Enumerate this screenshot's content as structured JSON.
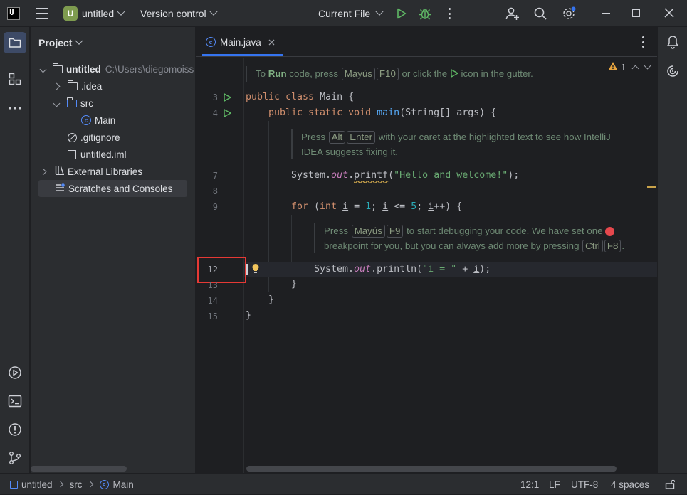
{
  "titlebar": {
    "logo": "IJ",
    "project_badge": "U",
    "project_name": "untitled",
    "vcs": "Version control",
    "run_config": "Current File",
    "icons": [
      "hamburger-menu-icon",
      "run-icon",
      "debug-icon",
      "more-vert-icon",
      "add-user-icon",
      "search-icon",
      "settings-icon",
      "minimize-icon",
      "maximize-icon",
      "close-icon"
    ]
  },
  "project_panel": {
    "title": "Project",
    "tree": [
      {
        "label": "untitled",
        "path": "C:\\Users\\diegomoiss"
      },
      {
        "label": ".idea"
      },
      {
        "label": "src"
      },
      {
        "label": "Main"
      },
      {
        "label": ".gitignore"
      },
      {
        "label": "untitled.iml"
      },
      {
        "label": "External Libraries"
      },
      {
        "label": "Scratches and Consoles"
      }
    ]
  },
  "editor": {
    "tab_label": "Main.java",
    "warning_count": "1",
    "hints": {
      "run": {
        "a": "To ",
        "b": "Run",
        "c": " code, press ",
        "k1": "Mayús",
        "k2": "F10",
        "d": " or click the ",
        "e": " icon in the gutter."
      },
      "fix": {
        "a": "Press ",
        "k1": "Alt",
        "k2": "Enter",
        "b": " with your caret at the highlighted text to see how IntelliJ",
        "c": "IDEA suggests fixing it."
      },
      "debug": {
        "a": "Press ",
        "k1": "Mayús",
        "k2": "F9",
        "b": " to start debugging your code. We have set one ",
        "c": "breakpoint for you, but you can always add more by pressing ",
        "k3": "Ctrl",
        "k4": "F8",
        "d": "."
      }
    },
    "line_numbers": [
      "3",
      "4",
      "7",
      "8",
      "9",
      "12",
      "13",
      "14",
      "15"
    ],
    "code": {
      "l3": {
        "kw": "public class ",
        "rest": "Main {"
      },
      "l4": {
        "kw": "public static void ",
        "fn": "main",
        "rest": "(String[] args) {"
      },
      "l7": {
        "a": "System.",
        "b": "out",
        "c": ".",
        "d": "printf",
        "e": "(",
        "f": "\"Hello and welcome!\"",
        "g": ");"
      },
      "l9": {
        "kw1": "for ",
        "a": "(",
        "kw2": "int ",
        "v1": "i",
        "b": " = ",
        "n1": "1",
        "c": "; ",
        "v2": "i",
        "d": " <= ",
        "n2": "5",
        "e": "; ",
        "v3": "i",
        "f": "++) {"
      },
      "l12": {
        "a": "System.",
        "b": "out",
        "c": ".println(",
        "s": "\"i = \"",
        "d": " + ",
        "v": "i",
        "e": ");"
      },
      "l13": "}",
      "l14": "}",
      "l15": "}"
    }
  },
  "statusbar": {
    "crumbs": [
      "untitled",
      "src",
      "Main"
    ],
    "position": "12:1",
    "line_sep": "LF",
    "encoding": "UTF-8",
    "indent": "4 spaces"
  },
  "colors": {
    "accent": "#3574f0",
    "highlight_box": "#e53935",
    "breakpoint": "#e5484d"
  }
}
